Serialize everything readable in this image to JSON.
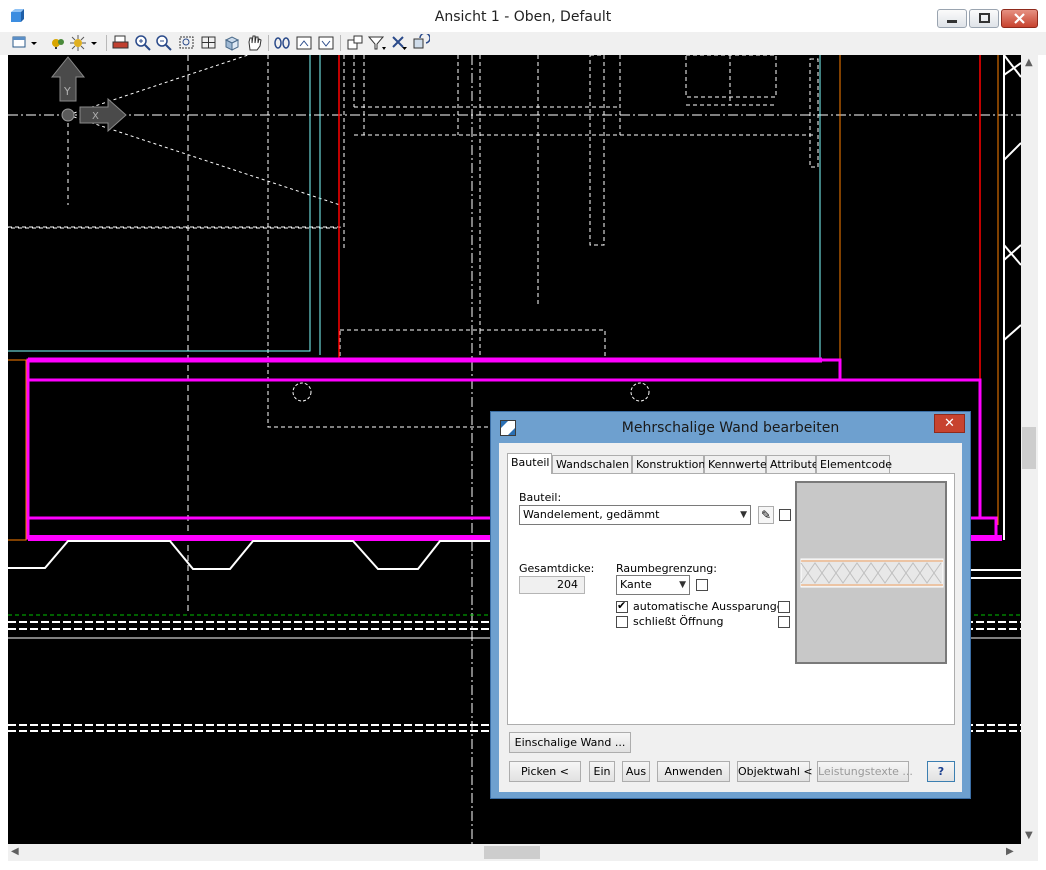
{
  "window": {
    "title": "Ansicht 1 - Oben, Default",
    "min_glyph": "—",
    "max_glyph": "□",
    "close_glyph": "✕"
  },
  "colors": {
    "canvas": "#000000",
    "magenta": "#ff00ff",
    "red": "#ff0000",
    "cyan": "#7fffff",
    "orange": "#ff8000",
    "white": "#ffffff",
    "green": "#00c000",
    "dialog_frame": "#6ea0cf"
  },
  "toolbar": {
    "icons": [
      "window-icon",
      "dropdown-arrow-icon",
      "layers-icon",
      "sun-icon",
      "dropdown-arrow-icon",
      "print-icon",
      "zoom-in-icon",
      "zoom-out-icon",
      "zoom-window-icon",
      "zoom-all-icon",
      "view-cube-icon",
      "pan-hand-icon",
      "walk-icon",
      "previous-view-icon",
      "next-view-icon",
      "window-arrange-icon",
      "filter-icon",
      "selection-icon",
      "refresh-icon"
    ]
  },
  "dialog": {
    "title": "Mehrschalige Wand bearbeiten",
    "close_glyph": "✕",
    "tabs": [
      "Bauteil",
      "Wandschalen",
      "Konstruktion",
      "Kennwerte",
      "Attribute",
      "Elementcode"
    ],
    "active_tab": "Bauteil",
    "bauteil_label": "Bauteil:",
    "bauteil_value": "Wandelement, gedämmt",
    "gesamtdicke_label": "Gesamtdicke:",
    "gesamtdicke_value": "204",
    "raumbegrenzung_label": "Raumbegrenzung:",
    "raumbegrenzung_value": "Kante",
    "auto_aussparungen_label": "automatische Aussparungen",
    "auto_aussparungen_checked": true,
    "schliesst_oeffnung_label": "schließt Öffnung",
    "schliesst_oeffnung_checked": false,
    "buttons": {
      "einschalige": "Einschalige Wand ...",
      "picken": "Picken <",
      "ein": "Ein",
      "aus": "Aus",
      "anwenden": "Anwenden",
      "objektwahl": "Objektwahl <",
      "leistungstexte": "Leistungstexte ...",
      "help": "?"
    }
  }
}
